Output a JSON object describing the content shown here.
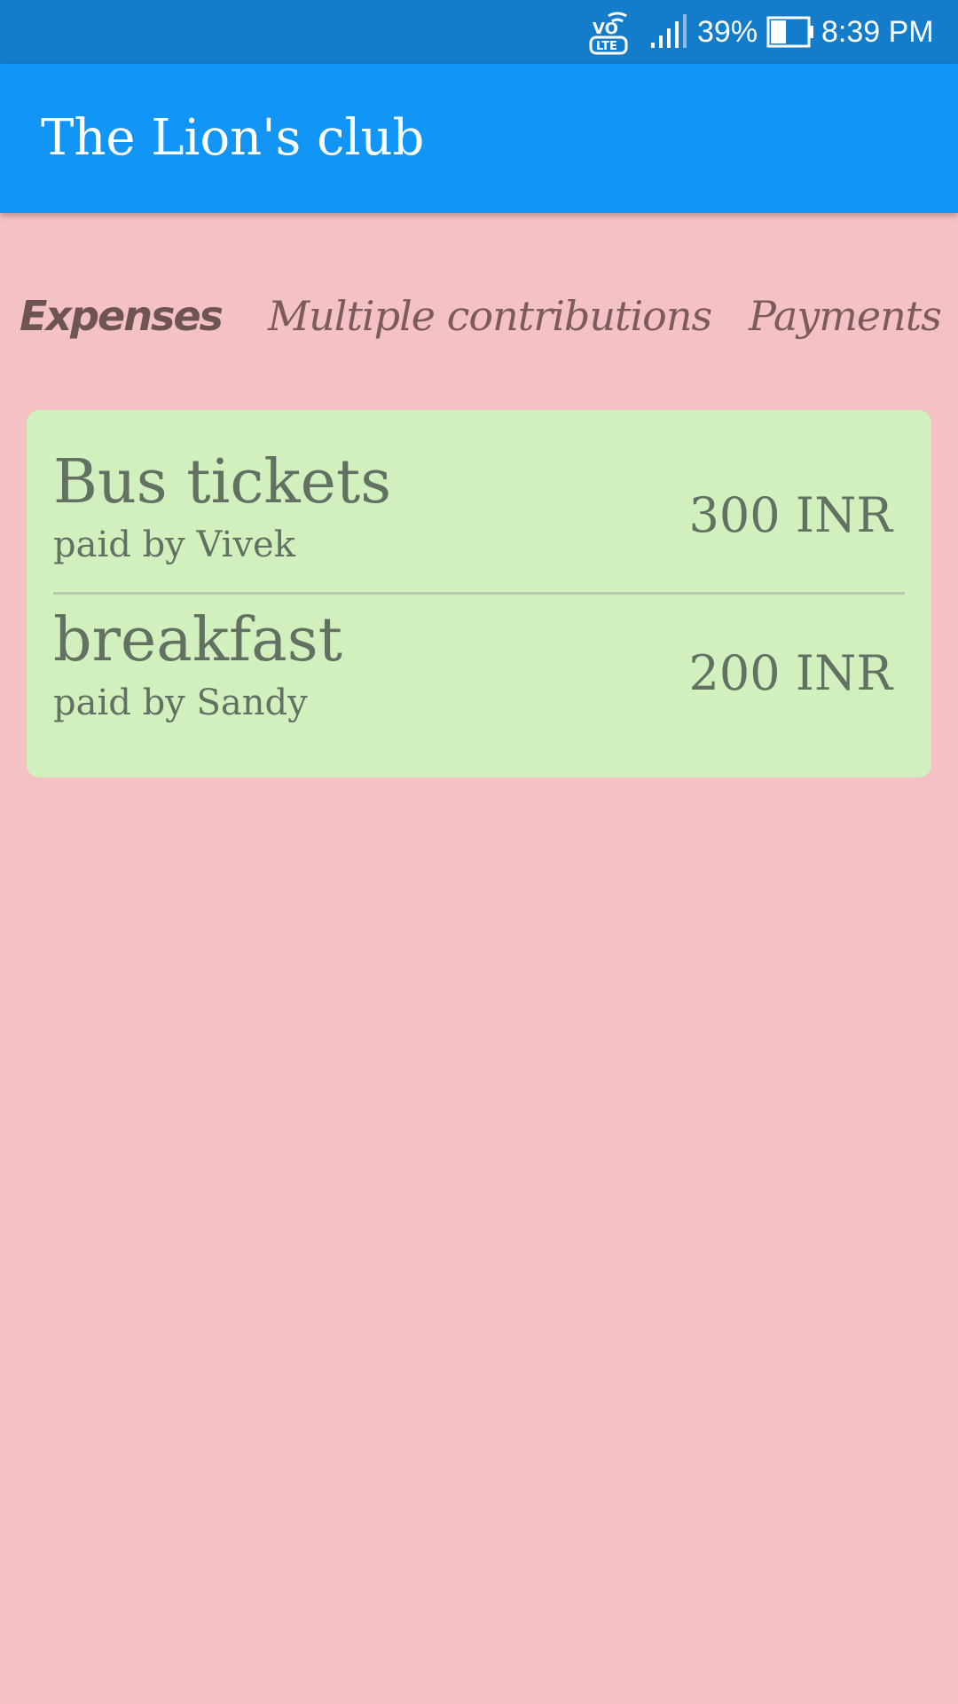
{
  "status_bar": {
    "volte_icon": "volte-lte-icon",
    "signal_icon": "signal-strength-icon",
    "battery_percent": "39%",
    "battery_icon": "battery-icon",
    "time": "8:39 PM"
  },
  "app_bar": {
    "title": "The Lion's club",
    "color": "#1195f6"
  },
  "tabs": [
    {
      "label": "Expenses",
      "selected": true
    },
    {
      "label": "Multiple contributions",
      "selected": false
    },
    {
      "label": "Payments",
      "selected": false
    }
  ],
  "expenses": [
    {
      "title": "Bus tickets",
      "payer": "paid by Vivek",
      "amount": "300 INR"
    },
    {
      "title": "breakfast",
      "payer": "paid by Sandy",
      "amount": "200 INR"
    }
  ],
  "colors": {
    "background": "#f4c1c4",
    "card": "#d1f0be",
    "status_bar": "#147dcb"
  }
}
